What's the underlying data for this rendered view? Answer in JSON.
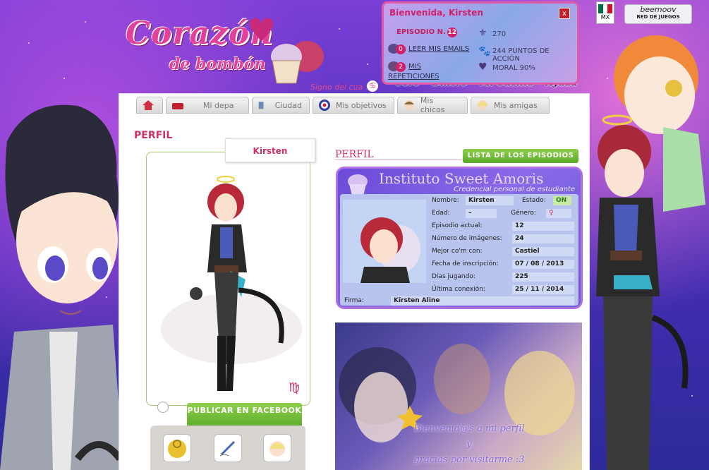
{
  "brand": {
    "logo_title": "Corazón",
    "logo_sub": "de bombón",
    "sign_label": "Signo del cua :",
    "sign_symbol": "♋"
  },
  "top_links": [
    "Foro",
    "Dinero",
    "Mi Cuenta",
    "Ayuda"
  ],
  "welcome": {
    "title": "Bienvenida, Kirsten",
    "close": "x",
    "episode_label": "EPISODIO N.",
    "episode_number": "12",
    "mail_badge": "0",
    "mail_link": "LEER MIS EMAILS",
    "rep_badge": "2",
    "rep_link": "MIS REPETICIONES",
    "dollars": "270",
    "action_points": "244 PUNTOS DE ACCIÓN",
    "moral": "MORAL 90%"
  },
  "locale": {
    "flag_label": "MX",
    "flag_colors": [
      "#006847",
      "#ffffff",
      "#ce1126"
    ]
  },
  "network": {
    "name": "beemoov",
    "sub": "RED DE JUEGOS"
  },
  "nav": [
    {
      "label": "",
      "icon": "home-icon"
    },
    {
      "label": "Mi depa",
      "icon": "sofa-icon"
    },
    {
      "label": "Ciudad",
      "icon": "building-icon"
    },
    {
      "label": "Mis objetivos",
      "icon": "target-icon"
    },
    {
      "label": "Mis chicos",
      "icon": "boy-icon"
    },
    {
      "label": "Mis amigas",
      "icon": "girl-icon"
    }
  ],
  "profile": {
    "heading": "PERFIL",
    "name": "Kirsten",
    "zodiac": "♍",
    "fb_button": "PUBLICAR EN FACEBOOK",
    "tools": [
      "lock-icon",
      "pen-icon",
      "character-icon"
    ]
  },
  "right": {
    "heading": "PERFIL",
    "episodes_button": "LISTA DE LOS EPISODIOS"
  },
  "card": {
    "title": "Instituto Sweet Amoris",
    "subtitle": "Credencial personal de estudiante",
    "fields": {
      "nombre_l": "Nombre:",
      "nombre": "Kirsten",
      "estado_l": "Estado:",
      "estado": "ON",
      "edad_l": "Edad:",
      "edad": "–",
      "genero_l": "Género:",
      "genero": "♀",
      "episodio_l": "Episodio actual:",
      "episodio": "12",
      "imagenes_l": "Número de imágenes:",
      "imagenes": "24",
      "mejor_l": "Mejor co'm con:",
      "mejor": "Castiel",
      "fecha_l": "Fecha de inscripción:",
      "fecha": "07 / 08 / 2013",
      "dias_l": "Días jugando:",
      "dias": "225",
      "ultima_l": "Última conexión:",
      "ultima": "25 / 11 / 2014",
      "firma_l": "Firma:",
      "firma": "Kirsten Aline"
    }
  },
  "banner": {
    "line1": "Bienvenid@s a mi perfil",
    "line2": "y",
    "line3": "gracias por visitarme :3"
  }
}
